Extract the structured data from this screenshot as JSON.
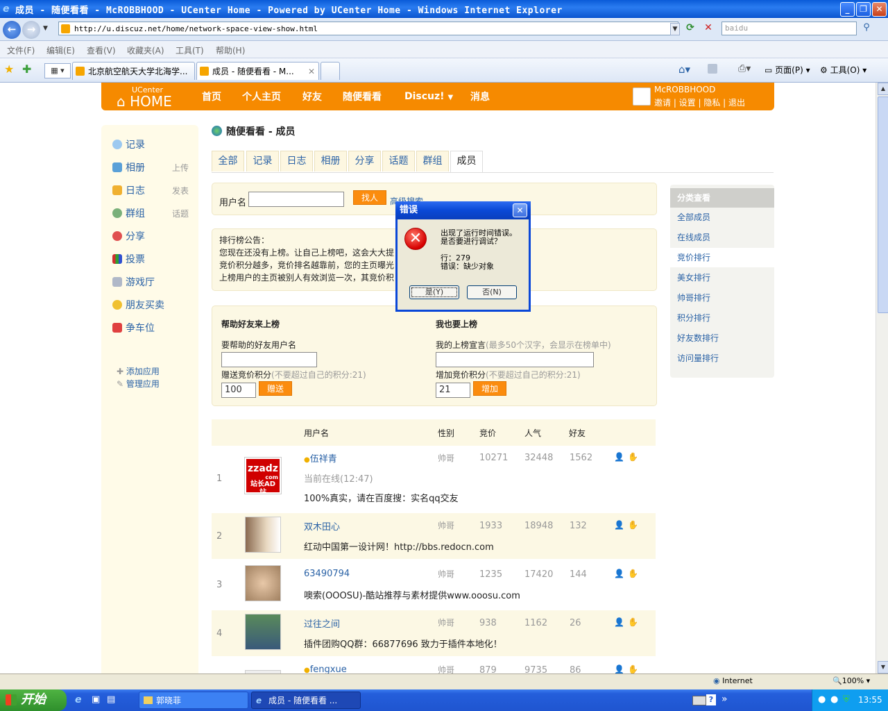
{
  "window": {
    "title": "成员 - 随便看看 - McROBBHOOD - UCenter Home - Powered by UCenter Home - Windows Internet Explorer"
  },
  "addressbar": {
    "url": "http://u.discuz.net/home/network-space-view-show.html",
    "search_placeholder": "baidu"
  },
  "menubar": [
    "文件(F)",
    "编辑(E)",
    "查看(V)",
    "收藏夹(A)",
    "工具(T)",
    "帮助(H)"
  ],
  "tabs": [
    {
      "label": "北京航空航天大学北海学..."
    },
    {
      "label": "成员 - 随便看看 - M..."
    }
  ],
  "commandbar": {
    "page": "页面(P)",
    "tools": "工具(O)"
  },
  "site": {
    "logo_top": "UCenter",
    "logo": "HOME",
    "nav": [
      "首页",
      "个人主页",
      "好友",
      "随便看看",
      "Discuz!",
      "消息"
    ],
    "username": "McROBBHOOD",
    "user_links": "邀请 | 设置 | 隐私 | 退出"
  },
  "leftnav": {
    "items": [
      {
        "label": "记录",
        "sub": ""
      },
      {
        "label": "相册",
        "sub": "上传"
      },
      {
        "label": "日志",
        "sub": "发表"
      },
      {
        "label": "群组",
        "sub": "话题"
      },
      {
        "label": "分享",
        "sub": ""
      },
      {
        "label": "投票",
        "sub": ""
      },
      {
        "label": "游戏厅",
        "sub": ""
      },
      {
        "label": "朋友买卖",
        "sub": ""
      },
      {
        "label": "争车位",
        "sub": ""
      }
    ],
    "add_app": "添加应用",
    "manage_app": "管理应用"
  },
  "crumb": {
    "section": "随便看看",
    "page": " - 成员"
  },
  "subtabs": [
    "全部",
    "记录",
    "日志",
    "相册",
    "分享",
    "话题",
    "群组",
    "成员"
  ],
  "search": {
    "label": "用户名",
    "button": "找人",
    "advanced": "高级搜索"
  },
  "notice": {
    "title": "排行榜公告：",
    "lines": [
      "您现在还没有上榜。让自己上榜吧，这会大大提",
      "竞价积分越多，竞价排名越靠前，您的主页曝光",
      "上榜用户的主页被别人有效浏览一次，其竞价积"
    ]
  },
  "help_friend": {
    "title": "帮助好友来上榜",
    "friend_label": "要帮助的好友用户名",
    "points_label": "赠送竞价积分",
    "points_hint": "(不要超过自己的积分:21)",
    "points_value": "100",
    "button": "赠送"
  },
  "self_rank": {
    "title": "我也要上榜",
    "slogan_label": "我的上榜宣言",
    "slogan_hint": "(最多50个汉字，会显示在榜单中)",
    "points_label": "增加竞价积分",
    "points_hint": "(不要超过自己的积分:21)",
    "points_value": "21",
    "button": "增加"
  },
  "category": {
    "title": "分类查看",
    "items": [
      "全部成员",
      "在线成员",
      "竞价排行",
      "美女排行",
      "帅哥排行",
      "积分排行",
      "好友数排行",
      "访问量排行"
    ]
  },
  "table": {
    "headers": [
      "用户名",
      "性别",
      "竞价",
      "人气",
      "好友"
    ],
    "rows": [
      {
        "rank": "1",
        "name": "伍祥青",
        "gender": "帅哥",
        "bid": "10271",
        "pop": "32448",
        "friends": "1562",
        "extra": "当前在线(12:47)",
        "text": "100%真实，请在百度搜：实名qq交友",
        "thumb_top": "zzadz",
        "thumb_mid": "com",
        "thumb_bot": "站长AD站"
      },
      {
        "rank": "2",
        "name": "双木田心",
        "gender": "帅哥",
        "bid": "1933",
        "pop": "18948",
        "friends": "132",
        "extra": "",
        "text": "红动中国第一设计网！http://bbs.redocn.com"
      },
      {
        "rank": "3",
        "name": "63490794",
        "gender": "帅哥",
        "bid": "1235",
        "pop": "17420",
        "friends": "144",
        "extra": "",
        "text": "噢索(OOOSU)-酷站推荐与素材提供www.ooosu.com"
      },
      {
        "rank": "4",
        "name": "过往之间",
        "gender": "帅哥",
        "bid": "938",
        "pop": "1162",
        "friends": "26",
        "extra": "",
        "text": "插件团购QQ群：66877696 致力于插件本地化！"
      },
      {
        "rank": "",
        "name": "fengxue",
        "gender": "帅哥",
        "bid": "879",
        "pop": "9735",
        "friends": "86",
        "extra": "",
        "text": ""
      }
    ]
  },
  "dialog": {
    "title": "错误",
    "line1": "出现了运行时间错误。",
    "line2": "是否要进行调试？",
    "line3": "行：279",
    "line4": "错误：缺少对象",
    "yes": "是(Y)",
    "no": "否(N)"
  },
  "statusbar": {
    "zone": "Internet",
    "zoom": "100%"
  },
  "taskbar": {
    "start": "开始",
    "tasks": [
      "郭晓菲",
      "成员 - 随便看看 ..."
    ],
    "clock": "13:55"
  },
  "colors": {
    "accent": "#f68a00",
    "link": "#2a62a6",
    "panel": "#fcf8e4"
  }
}
